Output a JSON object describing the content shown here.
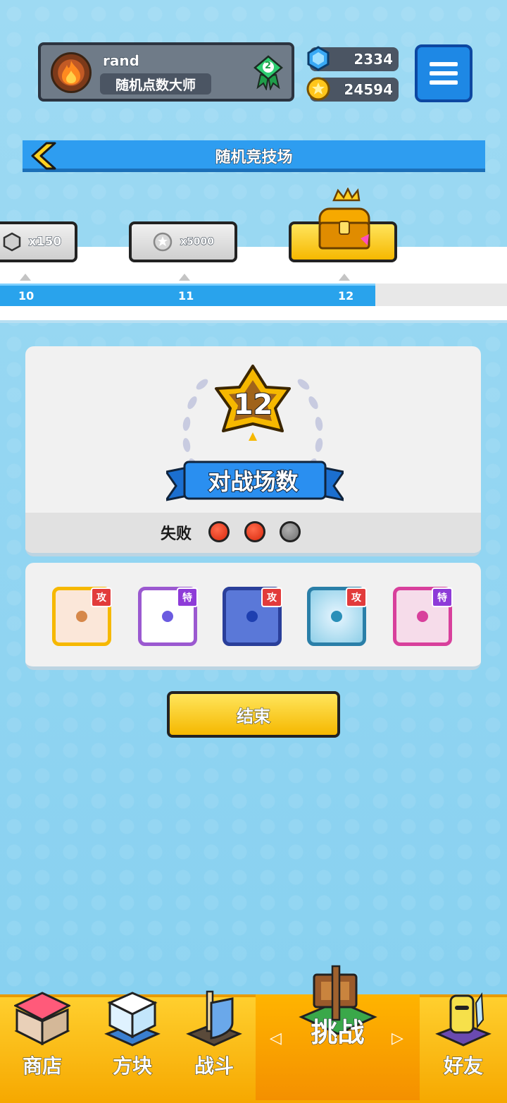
{
  "header": {
    "username": "rand",
    "title": "随机点数大师",
    "rank_level": "2",
    "gems": "2334",
    "coins": "24594"
  },
  "arena": {
    "title": "随机竞技场"
  },
  "track": {
    "ticks": [
      "10",
      "11",
      "12"
    ],
    "progress_fraction": 0.74,
    "rewards": [
      {
        "label": "x150",
        "icon": "gem-icon"
      },
      {
        "label": "x5000",
        "icon": "coin-icon"
      },
      {
        "label": "",
        "icon": "treasure-chest-icon"
      }
    ]
  },
  "summary": {
    "battle_count": "12",
    "banner": "对战场数",
    "loss_label": "失败",
    "losses": 2,
    "max_losses": 3
  },
  "deck": {
    "dice": [
      {
        "tag": "攻",
        "type": "attack",
        "color": "#f5b800"
      },
      {
        "tag": "特",
        "type": "special",
        "color": "#8e3bd8"
      },
      {
        "tag": "攻",
        "type": "attack",
        "color": "#4060c0"
      },
      {
        "tag": "攻",
        "type": "attack",
        "color": "#2a8fb8"
      },
      {
        "tag": "特",
        "type": "special",
        "color": "#d8409c"
      }
    ]
  },
  "end_button": "结束",
  "nav": {
    "shop": "商店",
    "dice": "方块",
    "battle": "战斗",
    "challenge": "挑战",
    "friends": "好友"
  }
}
